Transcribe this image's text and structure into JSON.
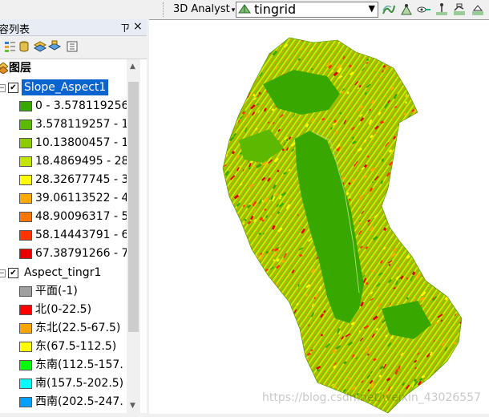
{
  "toolbar": {
    "analyst_label": "3D Analyst",
    "layer_select_value": "tingrid"
  },
  "toc": {
    "title": "容列表",
    "pin": "ㄗ",
    "close": "×",
    "layers_root_label": "图层",
    "layers": [
      {
        "name": "Slope_Aspect1",
        "selected": true,
        "checked": true,
        "classes": [
          {
            "label": "0 - 3.578119256",
            "color": "#38a800"
          },
          {
            "label": "3.578119257 - 1",
            "color": "#5cb800"
          },
          {
            "label": "10.13800457 - 1",
            "color": "#8ccc00"
          },
          {
            "label": "18.4869495 - 28",
            "color": "#c4e600"
          },
          {
            "label": "28.32677745 - 3",
            "color": "#ffff00"
          },
          {
            "label": "39.06113522 - 4",
            "color": "#ffaa00"
          },
          {
            "label": "48.90096317 - 5",
            "color": "#ff7700"
          },
          {
            "label": "58.14443791 - 6",
            "color": "#ff3300"
          },
          {
            "label": "67.38791266 - 7",
            "color": "#e60000"
          }
        ]
      },
      {
        "name": "Aspect_tingr1",
        "selected": false,
        "checked": true,
        "classes": [
          {
            "label": "平面(-1)",
            "color": "#a0a0a0"
          },
          {
            "label": "北(0-22.5)",
            "color": "#ff0000"
          },
          {
            "label": "东北(22.5-67.5)",
            "color": "#ffa500"
          },
          {
            "label": "东(67.5-112.5)",
            "color": "#ffff00"
          },
          {
            "label": "东南(112.5-157.",
            "color": "#00ff00"
          },
          {
            "label": "南(157.5-202.5)",
            "color": "#00ffff"
          },
          {
            "label": "西南(202.5-247.",
            "color": "#00a0ff"
          }
        ]
      }
    ]
  },
  "map": {
    "watermark": "https://blog.csdn.net/weixin_43026557"
  }
}
